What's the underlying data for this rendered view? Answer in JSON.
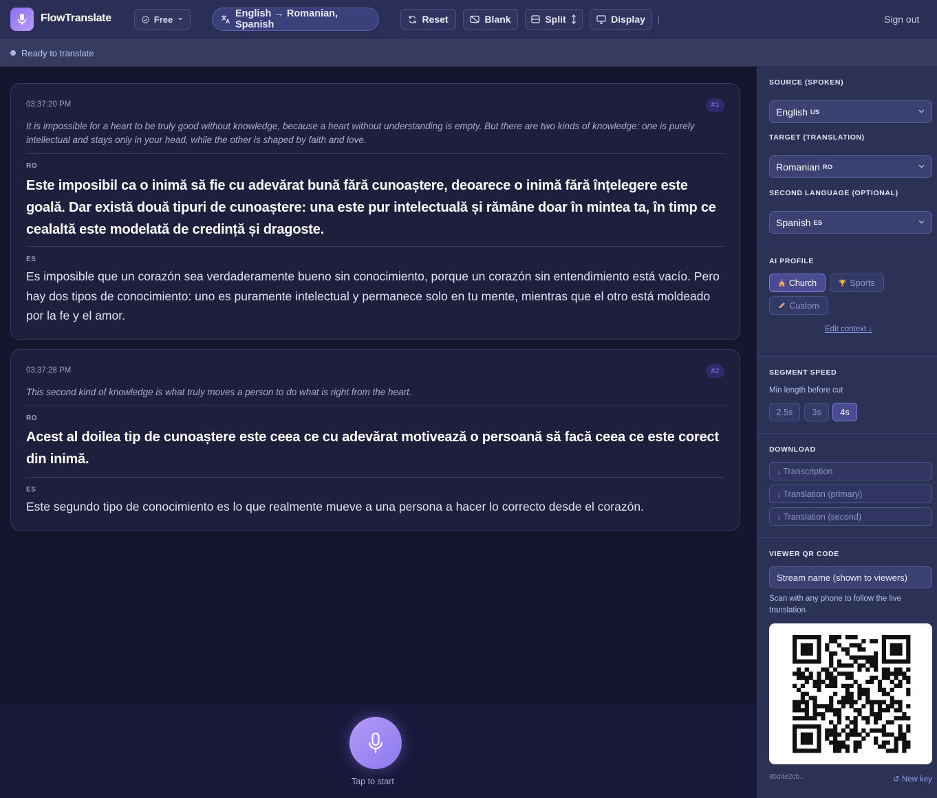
{
  "app": {
    "name": "FlowTranslate"
  },
  "toolbar": {
    "plan": "Free",
    "language_pair": "English → Romanian, Spanish",
    "reset": "Reset",
    "blank": "Blank",
    "split": "Split",
    "display": "Display",
    "sign_out": "Sign out"
  },
  "status": {
    "text": "Ready to translate"
  },
  "segments": [
    {
      "time": "03:37:20 PM",
      "num": "#1",
      "original": "It is impossible for a heart to be truly good without knowledge, because a heart without understanding is empty. But there are two kinds of knowledge: one is purely intellectual and stays only in your head, while the other is shaped by faith and love.",
      "primary_code": "RO",
      "primary": "Este imposibil ca o inimă să fie cu adevărat bună fără cunoaștere, deoarece o inimă fără înțelegere este goală. Dar există două tipuri de cunoaștere: una este pur intelectuală și rămâne doar în mintea ta, în timp ce cealaltă este modelată de credință și dragoste.",
      "second_code": "ES",
      "second": "Es imposible que un corazón sea verdaderamente bueno sin conocimiento, porque un corazón sin entendimiento está vacío. Pero hay dos tipos de conocimiento: uno es puramente intelectual y permanece solo en tu mente, mientras que el otro está moldeado por la fe y el amor."
    },
    {
      "time": "03:37:28 PM",
      "num": "#2",
      "original": "This second kind of knowledge is what truly moves a person to do what is right from the heart.",
      "primary_code": "RO",
      "primary": "Acest al doilea tip de cunoaștere este ceea ce cu adevărat motivează o persoană să facă ceea ce este corect din inimă.",
      "second_code": "ES",
      "second": "Este segundo tipo de conocimiento es lo que realmente mueve a una persona a hacer lo correcto desde el corazón."
    }
  ],
  "mic": {
    "label": "Tap to start"
  },
  "sidebar": {
    "source_heading": "SOURCE (SPOKEN)",
    "source_value": "English",
    "source_code": "US",
    "target_heading": "TARGET (TRANSLATION)",
    "target_value": "Romanian",
    "target_code": "RO",
    "second_heading": "SECOND LANGUAGE (OPTIONAL)",
    "second_value": "Spanish",
    "second_code": "ES",
    "ai_heading": "AI PROFILE",
    "profiles": [
      "Church",
      "Sports",
      "Custom"
    ],
    "profile_active": "Church",
    "edit_context": "Edit context ↓",
    "speed_heading": "SEGMENT SPEED",
    "speed_sub": "Min length before cut",
    "speeds": [
      "2.5s",
      "3s",
      "4s"
    ],
    "speed_active": "4s",
    "download_heading": "DOWNLOAD",
    "downloads": [
      "↓ Transcription",
      "↓ Translation (primary)",
      "↓ Translation (second)"
    ],
    "qr_heading": "VIEWER QR CODE",
    "stream_placeholder": "Stream name (shown to viewers)",
    "scan_text": "Scan with any phone to follow the live translation",
    "key": "80d4e2cb...",
    "new_key": "↺ New key"
  },
  "colors": {
    "accent": "#9b86f2",
    "background": "#15152e",
    "sidebar": "#2c3256",
    "card": "#1e1f3d"
  }
}
